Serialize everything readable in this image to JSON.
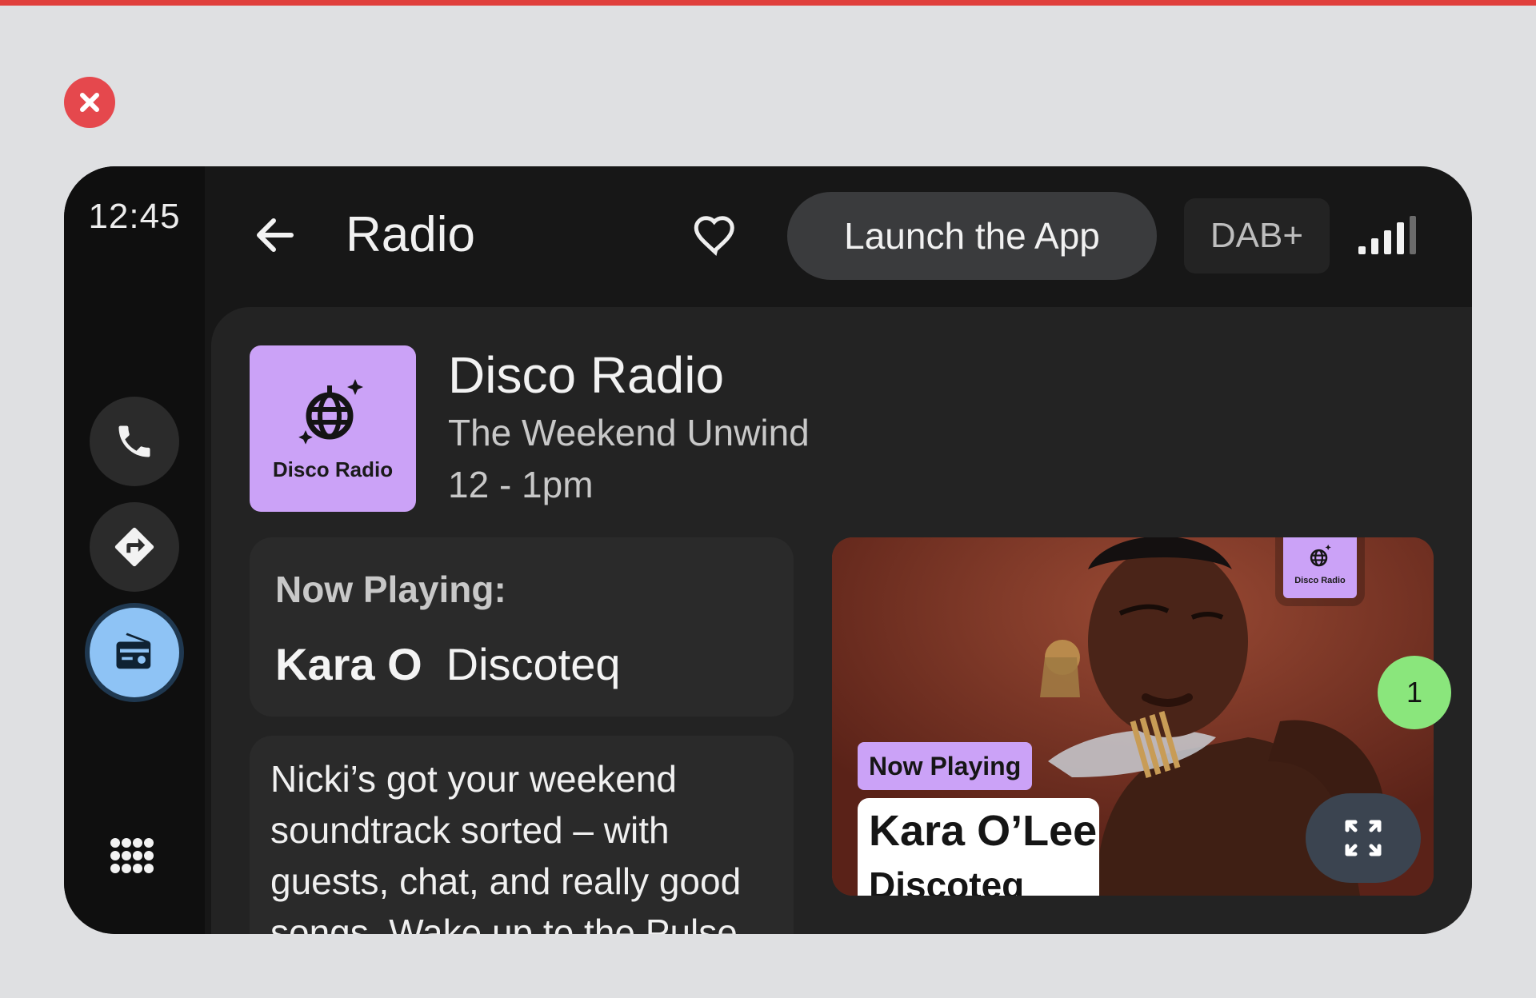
{
  "window": {
    "close_label": "Close"
  },
  "rail": {
    "clock": "12:45",
    "items": [
      {
        "icon": "phone-icon",
        "label": "Phone"
      },
      {
        "icon": "navigation-icon",
        "label": "Navigation"
      },
      {
        "icon": "radio-icon",
        "label": "Radio",
        "active": true
      }
    ],
    "apps_icon": "app-grid-icon"
  },
  "header": {
    "title": "Radio",
    "launch_label": "Launch the App",
    "band_label": "DAB+",
    "signal_bars": 4
  },
  "station": {
    "art_label": "Disco Radio",
    "name": "Disco Radio",
    "program": "The Weekend Unwind",
    "time": "12 - 1pm"
  },
  "now_playing": {
    "label": "Now Playing:",
    "artist": "Kara O",
    "song": "Discoteq"
  },
  "description": "Nicki’s got your weekend soundtrack sorted – with guests, chat, and really good songs. Wake up to the Pulse",
  "album": {
    "logo_label": "Disco Radio",
    "badge": "Now Playing",
    "artist": "Kara O’Lee",
    "song": "Discoteq"
  },
  "notification_count": "1",
  "colors": {
    "accent_purple": "#cba2f7",
    "active_blue": "#8ec3f5",
    "badge_green": "#8ae67c",
    "close_red": "#e5484d"
  }
}
